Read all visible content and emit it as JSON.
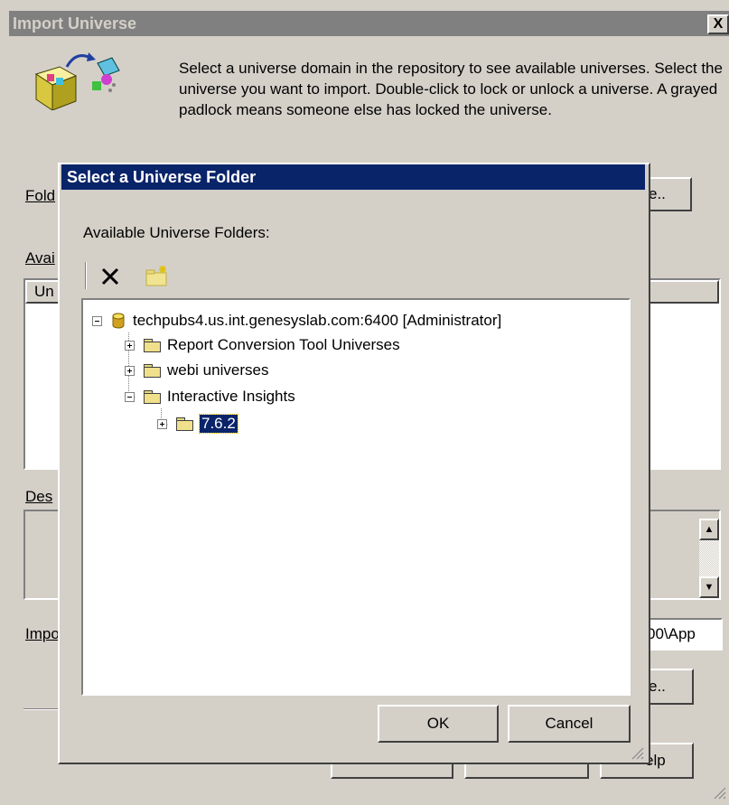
{
  "back_dialog": {
    "title": "Import Universe",
    "close_glyph": "X",
    "description": "Select a universe domain in the repository to see available universes. Select the universe you want to import. Double-click to lock or unlock a universe. A grayed padlock means someone else has locked the universe.",
    "folder_label": "Fold",
    "browse_label": "e..",
    "available_label": "Avai",
    "list_header": "Un",
    "description_label": "Des",
    "import_label": "Impo",
    "import_path_fragment": "00\\App",
    "browse2_label": "e..",
    "help_label": "elp"
  },
  "dialog": {
    "title": "Select a Universe Folder",
    "available_label": "Available Universe Folders:",
    "toolbar": {
      "delete_icon": "delete-x-icon",
      "new_folder_icon": "new-folder-icon"
    },
    "tree": {
      "root": "techpubs4.us.int.genesyslab.com:6400 [Administrator]",
      "items": [
        {
          "label": "Report Conversion Tool Universes",
          "expander": "+"
        },
        {
          "label": "webi universes",
          "expander": "+"
        },
        {
          "label": "Interactive Insights",
          "expander": "-"
        }
      ],
      "child": {
        "label": "7.6.2",
        "expander": "+",
        "selected": true
      }
    },
    "ok_label": "OK",
    "cancel_label": "Cancel"
  }
}
